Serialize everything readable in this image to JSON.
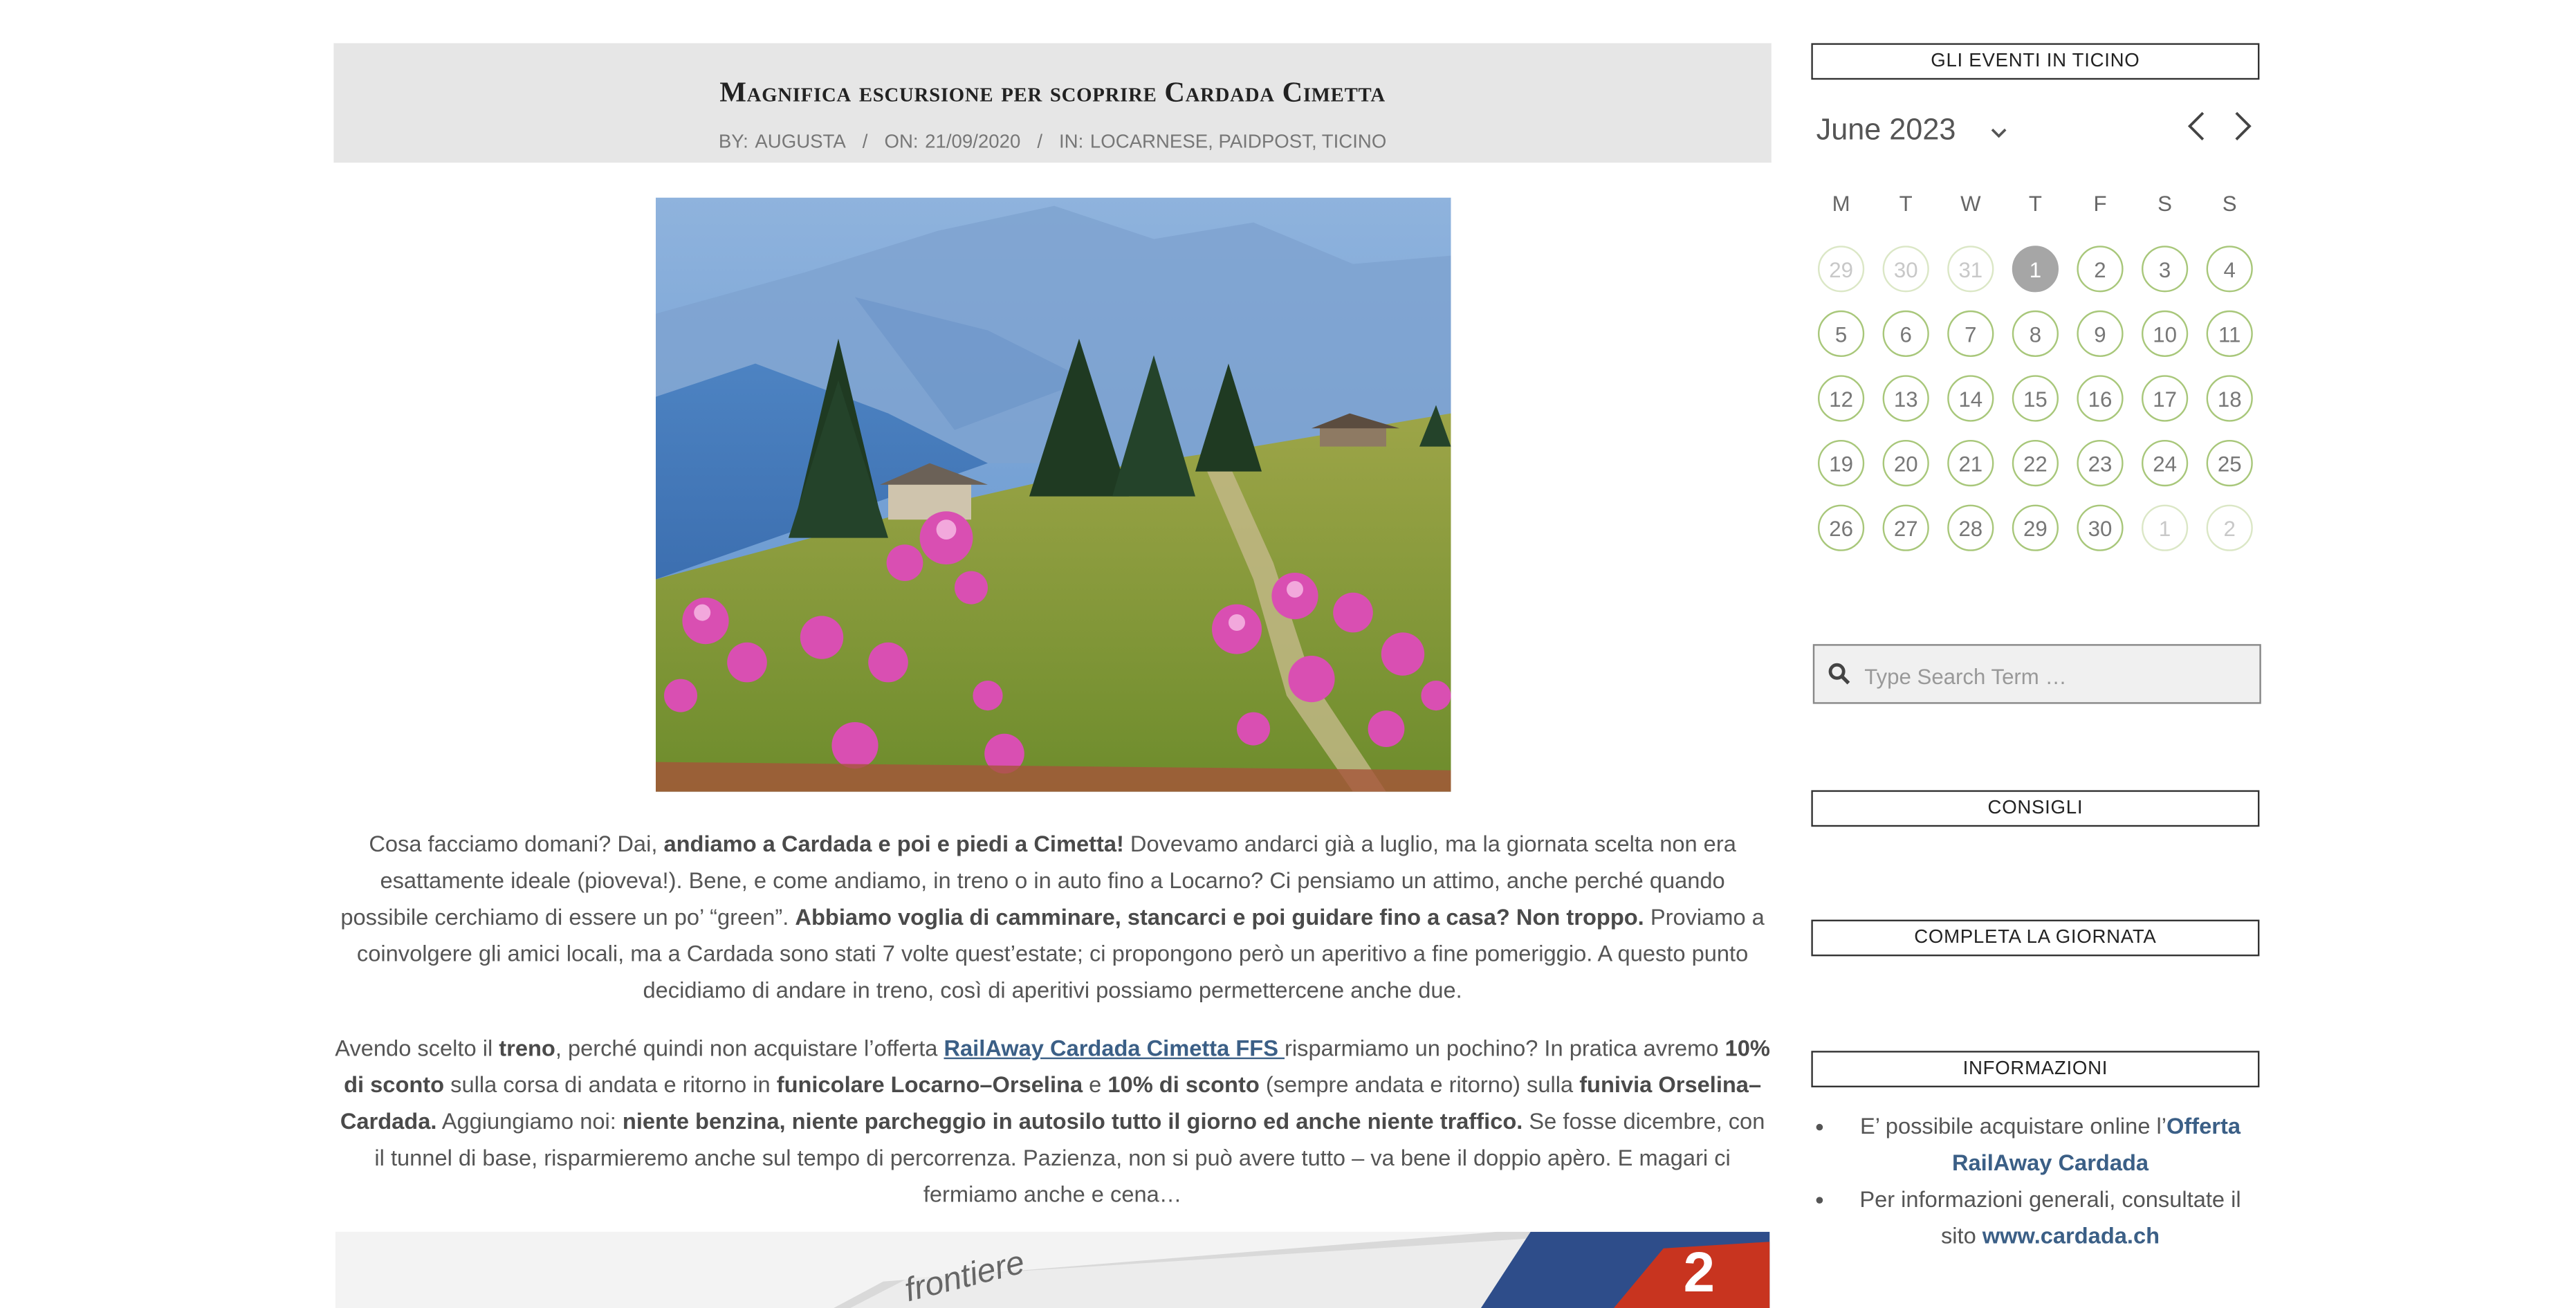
{
  "post": {
    "title": "Magnifica escursione per scoprire Cardada Cimetta",
    "meta": {
      "by_label": "BY:",
      "author": "AUGUSTA",
      "on_label": "ON:",
      "date": "21/09/2020",
      "in_label": "IN:",
      "categories": "LOCARNESE, PAIDPOST, TICINO",
      "separator": "/"
    },
    "p1": {
      "t1": "Cosa facciamo domani? Dai, ",
      "b1": "andiamo a Cardada e poi e piedi a Cimetta!",
      "t2": " Dovevamo andarci già a luglio, ma la giornata scelta non era esattamente ideale (pioveva!). Bene, e come andiamo, in treno o in auto fino a Locarno? Ci pensiamo un attimo, anche perché quando possibile cerchiamo di essere un po’ “green”. ",
      "b2": "Abbiamo voglia di camminare, stancarci e poi guidare fino a casa? Non troppo.",
      "t3": " Proviamo a coinvolgere gli amici locali, ma a Cardada sono stati 7 volte quest’estate; ci propongono però un aperitivo a fine pomeriggio. A questo punto decidiamo di andare in treno, così di aperitivi possiamo permettercene anche due."
    },
    "p2": {
      "t1": "Avendo scelto il ",
      "b1": "treno",
      "t2": ", perché quindi non acquistare l’offerta ",
      "link": "RailAway Cardada Cimetta FFS ",
      "t3": "risparmiamo un pochino? In pratica avremo ",
      "b2": "10% di sconto",
      "t4": " sulla corsa di andata e ritorno in ",
      "b3": "funicolare Locarno–Orselina",
      "t5": " e ",
      "b4": "10% di sconto",
      "t6": " (sempre andata e ritorno) sulla ",
      "b5": "funivia Orselina–Cardada.",
      "t7": " Aggiungiamo noi: ",
      "b6": "niente benzina, niente parcheggio in autosilo tutto il giorno ed anche niente traffico.",
      "t8": " Se fosse dicembre, con il tunnel di base, risparmieremo anche sul tempo di percorrenza. Pazienza, non si può avere tutto – va bene il doppio apèro. E magari ci fermiamo anche e cena…"
    },
    "train_image_text": "frontiere"
  },
  "sidebar": {
    "events_title": "GLI EVENTI IN TICINO",
    "calendar": {
      "month": "June 2023",
      "weekdays": [
        "M",
        "T",
        "W",
        "T",
        "F",
        "S",
        "S"
      ],
      "days": [
        [
          "29",
          "30",
          "31",
          "1",
          "2",
          "3",
          "4"
        ],
        [
          "5",
          "6",
          "7",
          "8",
          "9",
          "10",
          "11"
        ],
        [
          "12",
          "13",
          "14",
          "15",
          "16",
          "17",
          "18"
        ],
        [
          "19",
          "20",
          "21",
          "22",
          "23",
          "24",
          "25"
        ],
        [
          "26",
          "27",
          "28",
          "29",
          "30",
          "1",
          "2"
        ]
      ],
      "today": "1"
    },
    "search_placeholder": "Type Search Term …",
    "consigli_title": "CONSIGLI",
    "completa_title": "COMPLETA LA GIORNATA",
    "informazioni_title": "INFORMAZIONI",
    "info": {
      "item1_text": "E’ possibile acquistare online l’",
      "item1_link": "Offerta RailAway Cardada",
      "item2_text": "Per informazioni generali, consultate il sito ",
      "item2_link": "www.cardada.ch"
    }
  },
  "colors": {
    "calendar_ring": "#a8c77a",
    "link": "#3b5f86",
    "header_bg": "#e6e6e6"
  }
}
